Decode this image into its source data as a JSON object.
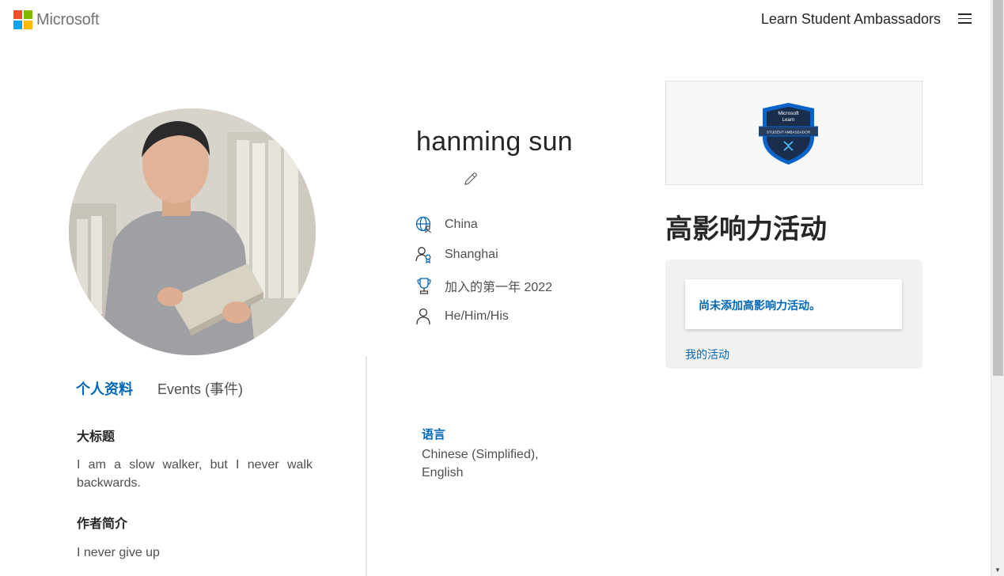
{
  "header": {
    "brand": "Microsoft",
    "site_title": "Learn Student Ambassadors"
  },
  "profile": {
    "name": "hanming sun",
    "country": "China",
    "city": "Shanghai",
    "joined": "加入的第一年 2022",
    "pronouns": "He/Him/His"
  },
  "tabs": [
    {
      "label": "个人资料"
    },
    {
      "label": "Events (事件)"
    }
  ],
  "about": {
    "headline_label": "大标题",
    "headline_text": "I am a slow walker, but I never walk backwards.",
    "bio_label": "作者简介",
    "bio_text": "I never give up"
  },
  "language": {
    "label": "语言",
    "value": "Chinese (Simplified), English"
  },
  "badge": {
    "line1": "Microsoft",
    "line2": "Learn",
    "ribbon": "STUDENT AMBASSADOR"
  },
  "impact": {
    "title": "高影响力活动",
    "empty_message": "尚未添加高影响力活动。",
    "my_activity_link": "我的活动"
  },
  "colors": {
    "accent": "#0067b8",
    "logo_red": "#f25022",
    "logo_green": "#7fba00",
    "logo_blue": "#00a4ef",
    "logo_yellow": "#ffb900"
  }
}
